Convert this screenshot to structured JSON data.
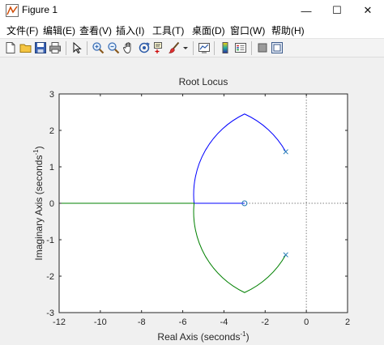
{
  "window": {
    "title": "Figure 1",
    "minimize_glyph": "—",
    "maximize_glyph": "☐",
    "close_glyph": "✕"
  },
  "menu": {
    "items": [
      {
        "label": "文件(F)"
      },
      {
        "label": "编辑(E)"
      },
      {
        "label": "查看(V)"
      },
      {
        "label": "插入(I)"
      },
      {
        "label": "工具(T)"
      },
      {
        "label": "桌面(D)"
      },
      {
        "label": "窗口(W)"
      },
      {
        "label": "帮助(H)"
      }
    ]
  },
  "toolbar": {
    "icons": [
      "new-file-icon",
      "open-folder-icon",
      "save-icon",
      "print-icon",
      "pointer-icon",
      "zoom-in-icon",
      "zoom-out-icon",
      "pan-hand-icon",
      "rotate-3d-icon",
      "data-cursor-icon",
      "brush-icon",
      "link-plot-icon",
      "colorbar-icon",
      "legend-icon",
      "hide-plot-tools-icon",
      "show-plot-tools-icon"
    ]
  },
  "chart_data": {
    "type": "line",
    "title": "Root Locus",
    "xlabel": "Real Axis (seconds",
    "xlabel_sup": "-1",
    "xlabel_end": ")",
    "ylabel": "Imaginary Axis (seconds",
    "ylabel_sup": "-1",
    "ylabel_end": ")",
    "xlim": [
      -12,
      2
    ],
    "ylim": [
      -3,
      3
    ],
    "xticks": [
      -12,
      -10,
      -8,
      -6,
      -4,
      -2,
      0,
      2
    ],
    "yticks": [
      -3,
      -2,
      -1,
      0,
      1,
      2,
      3
    ],
    "grid": false,
    "poles": [
      [
        -1,
        1.414
      ],
      [
        -1,
        -1.414
      ]
    ],
    "zeros": [
      [
        -3,
        0
      ]
    ],
    "series": [
      {
        "color": "#0000ff",
        "x": [
          -1.0,
          -3.0,
          -5.45,
          -3.0
        ],
        "y": [
          1.414,
          2.45,
          0.0,
          0.0
        ]
      },
      {
        "color": "#008000",
        "x": [
          -1.0,
          -3.0,
          -5.45,
          -12.0
        ],
        "y": [
          -1.414,
          -2.45,
          0.0,
          0.0
        ]
      }
    ],
    "colors": {
      "branch_1": "#0000ff",
      "branch_2": "#008000",
      "markers": "#1f77b4",
      "axes_text": "#262626",
      "reference_line": "#808080"
    }
  }
}
